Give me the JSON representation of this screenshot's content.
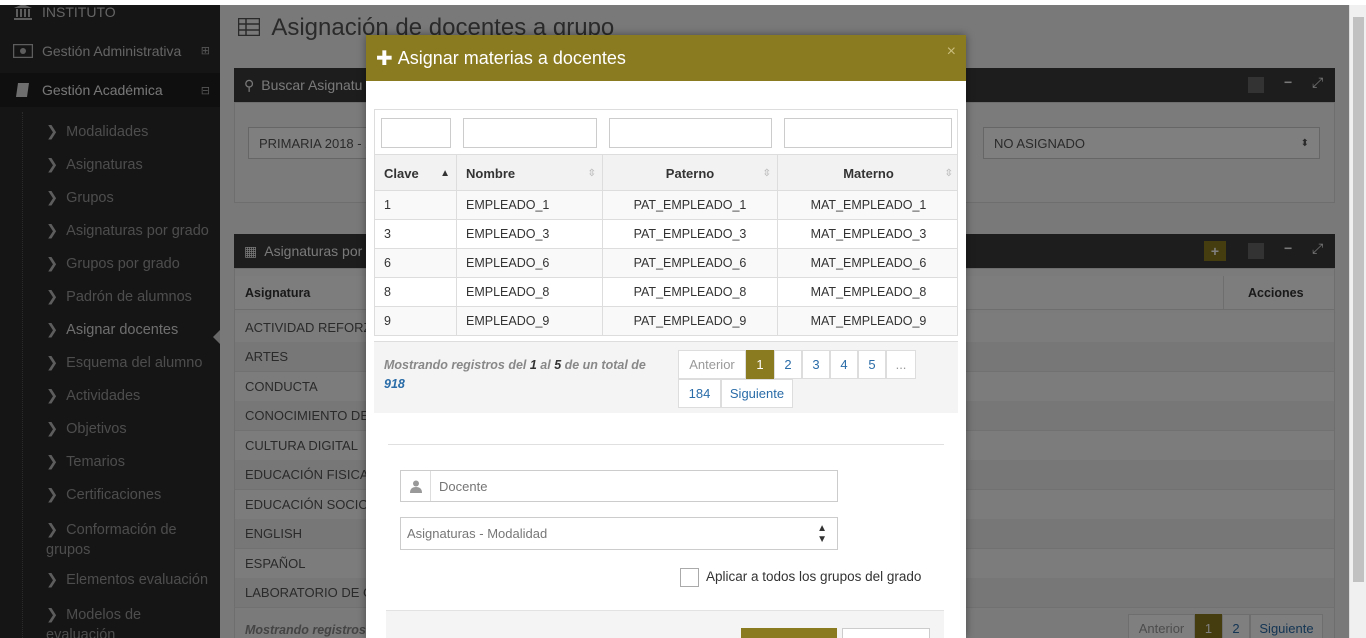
{
  "sidebar": {
    "top_label": "INSTITUTO",
    "main_items": [
      {
        "label": "Gestión Administrativa",
        "toggle": "⊞"
      },
      {
        "label": "Gestión Académica",
        "toggle": "⊟"
      }
    ],
    "sub_items": [
      "Modalidades",
      "Asignaturas",
      "Grupos",
      "Asignaturas por grado",
      "Grupos por grado",
      "Padrón de alumnos",
      "Asignar docentes",
      "Esquema del alumno",
      "Actividades",
      "Objetivos",
      "Temarios",
      "Certificaciones",
      "Conformación de grupos",
      "Elementos evaluación",
      "Modelos de evaluación"
    ]
  },
  "page": {
    "title": "Asignación de docentes a grupo",
    "panel1_title": "Buscar Asignatu",
    "panel1_select_left": "PRIMARIA 2018 - 2",
    "panel1_select_right": "NO ASIGNADO",
    "panel2_title": "Asignaturas por",
    "col_asignatura": "Asignatura",
    "col_acciones": "Acciones",
    "rows": [
      "ACTIVIDAD REFORZA",
      "ARTES",
      "CONDUCTA",
      "CONOCIMIENTO DEL",
      "CULTURA DIGITAL",
      "EDUCACIÓN FISICA",
      "EDUCACIÓN SOCIOE",
      "ENGLISH",
      "ESPAÑOL",
      "LABORATORIO DE C"
    ],
    "footer_info": "Mostrando registros",
    "pager": {
      "prev": "Anterior",
      "p1": "1",
      "p2": "2",
      "next": "Siguiente"
    }
  },
  "modal": {
    "title": "Asignar materias a docentes",
    "close": "×",
    "columns": [
      "Clave",
      "Nombre",
      "Paterno",
      "Materno"
    ],
    "rows": [
      [
        "1",
        "EMPLEADO_1",
        "PAT_EMPLEADO_1",
        "MAT_EMPLEADO_1"
      ],
      [
        "3",
        "EMPLEADO_3",
        "PAT_EMPLEADO_3",
        "MAT_EMPLEADO_3"
      ],
      [
        "6",
        "EMPLEADO_6",
        "PAT_EMPLEADO_6",
        "MAT_EMPLEADO_6"
      ],
      [
        "8",
        "EMPLEADO_8",
        "PAT_EMPLEADO_8",
        "MAT_EMPLEADO_8"
      ],
      [
        "9",
        "EMPLEADO_9",
        "PAT_EMPLEADO_9",
        "MAT_EMPLEADO_9"
      ]
    ],
    "info": {
      "pre": "Mostrando registros del ",
      "from": "1",
      "mid1": " al ",
      "to": "5",
      "mid2": " de un total de ",
      "total": "918"
    },
    "pager": {
      "prev": "Anterior",
      "pages": [
        "1",
        "2",
        "3",
        "4",
        "5",
        "..."
      ],
      "last": "184",
      "next": "Siguiente"
    },
    "docente_placeholder": "Docente",
    "asignaturas_select": "Asignaturas - Modalidad",
    "apply_all_label": "Aplicar a todos los grupos del grado"
  }
}
